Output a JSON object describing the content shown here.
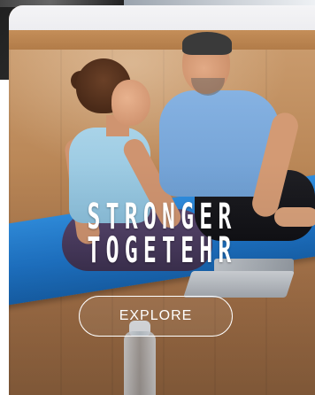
{
  "hero": {
    "headline_line1": "STRONGER",
    "headline_line2": "TOGETEHR",
    "cta_label": "EXPLORE",
    "image_subject": "couple-doing-yoga-photo"
  },
  "colors": {
    "text": "#ffffff",
    "mat": "#1f77cc",
    "floor": "#b98656"
  }
}
